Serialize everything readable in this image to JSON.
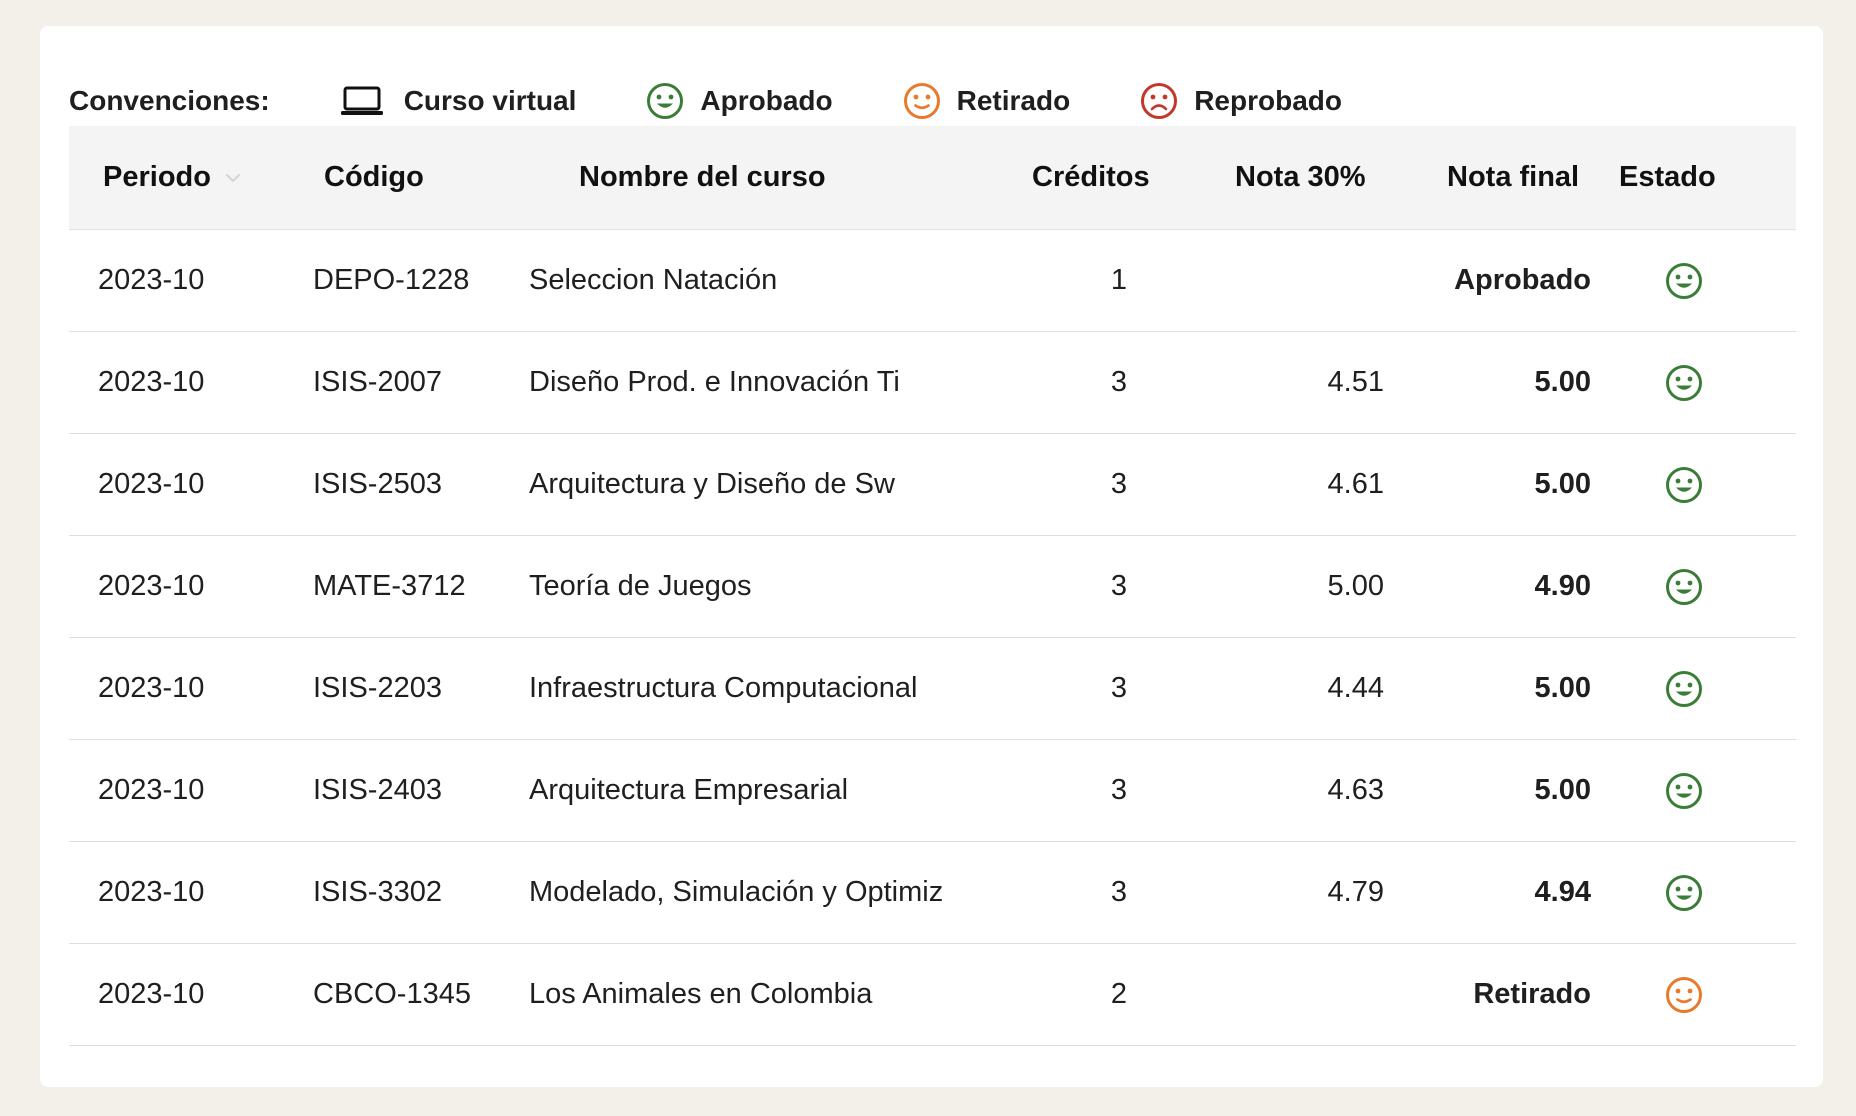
{
  "legend": {
    "title": "Convenciones:",
    "items": [
      {
        "icon": "laptop-icon",
        "label": "Curso virtual",
        "color": "#111111"
      },
      {
        "icon": "smile-icon",
        "label": "Aprobado",
        "color": "#3a7d36"
      },
      {
        "icon": "neutral-face-icon",
        "label": "Retirado",
        "color": "#e87a2c"
      },
      {
        "icon": "frown-icon",
        "label": "Reprobado",
        "color": "#c0392b"
      }
    ]
  },
  "table": {
    "headers": {
      "period": "Periodo",
      "code": "Código",
      "name": "Nombre del curso",
      "credits": "Créditos",
      "nota30": "Nota 30%",
      "final": "Nota final",
      "estado": "Estado"
    },
    "sort_icon": "chevron-down-icon",
    "rows": [
      {
        "period": "2023-10",
        "code": "DEPO-1228",
        "name": "Seleccion Natación",
        "credits": "1",
        "nota30": "",
        "final": "Aprobado",
        "status": "aprobado"
      },
      {
        "period": "2023-10",
        "code": "ISIS-2007",
        "name": "Diseño Prod. e Innovación Ti",
        "credits": "3",
        "nota30": "4.51",
        "final": "5.00",
        "status": "aprobado"
      },
      {
        "period": "2023-10",
        "code": "ISIS-2503",
        "name": "Arquitectura y Diseño de Sw",
        "credits": "3",
        "nota30": "4.61",
        "final": "5.00",
        "status": "aprobado"
      },
      {
        "period": "2023-10",
        "code": "MATE-3712",
        "name": "Teoría de Juegos",
        "credits": "3",
        "nota30": "5.00",
        "final": "4.90",
        "status": "aprobado"
      },
      {
        "period": "2023-10",
        "code": "ISIS-2203",
        "name": "Infraestructura Computacional",
        "credits": "3",
        "nota30": "4.44",
        "final": "5.00",
        "status": "aprobado"
      },
      {
        "period": "2023-10",
        "code": "ISIS-2403",
        "name": "Arquitectura Empresarial",
        "credits": "3",
        "nota30": "4.63",
        "final": "5.00",
        "status": "aprobado"
      },
      {
        "period": "2023-10",
        "code": "ISIS-3302",
        "name": "Modelado, Simulación y Optimiz",
        "credits": "3",
        "nota30": "4.79",
        "final": "4.94",
        "status": "aprobado"
      },
      {
        "period": "2023-10",
        "code": "CBCO-1345",
        "name": "Los Animales en Colombia",
        "credits": "2",
        "nota30": "",
        "final": "Retirado",
        "status": "retirado"
      }
    ]
  }
}
